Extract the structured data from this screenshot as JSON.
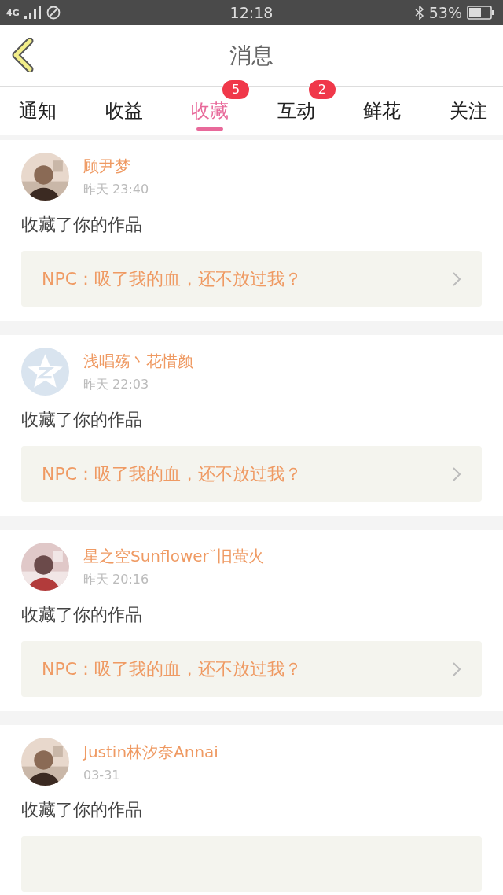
{
  "status_bar": {
    "network": "4G",
    "time": "12:18",
    "battery": "53%"
  },
  "header": {
    "title": "消息"
  },
  "tabs": [
    {
      "label": "通知",
      "selected": false
    },
    {
      "label": "收益",
      "selected": false
    },
    {
      "label": "收藏",
      "selected": true,
      "badge": "5"
    },
    {
      "label": "互动",
      "selected": false,
      "badge": "2"
    },
    {
      "label": "鲜花",
      "selected": false
    },
    {
      "label": "关注",
      "selected": false
    }
  ],
  "messages": [
    {
      "name": "顾尹梦",
      "time": "昨天 23:40",
      "action": "收藏了你的作品",
      "link": "NPC：吸了我的血，还不放过我？"
    },
    {
      "avatar": {
        "kind": "default"
      },
      "name": "浅唱殇丶花惜颜",
      "time": "昨天 22:03",
      "action": "收藏了你的作品",
      "link": "NPC：吸了我的血，还不放过我？"
    },
    {
      "name": "星之空Sunflower˘旧萤火",
      "time": "昨天 20:16",
      "action": "收藏了你的作品",
      "link": "NPC：吸了我的血，还不放过我？"
    },
    {
      "name": "Justin林汐奈Annai",
      "time": "03-31",
      "action": "收藏了你的作品"
    }
  ]
}
